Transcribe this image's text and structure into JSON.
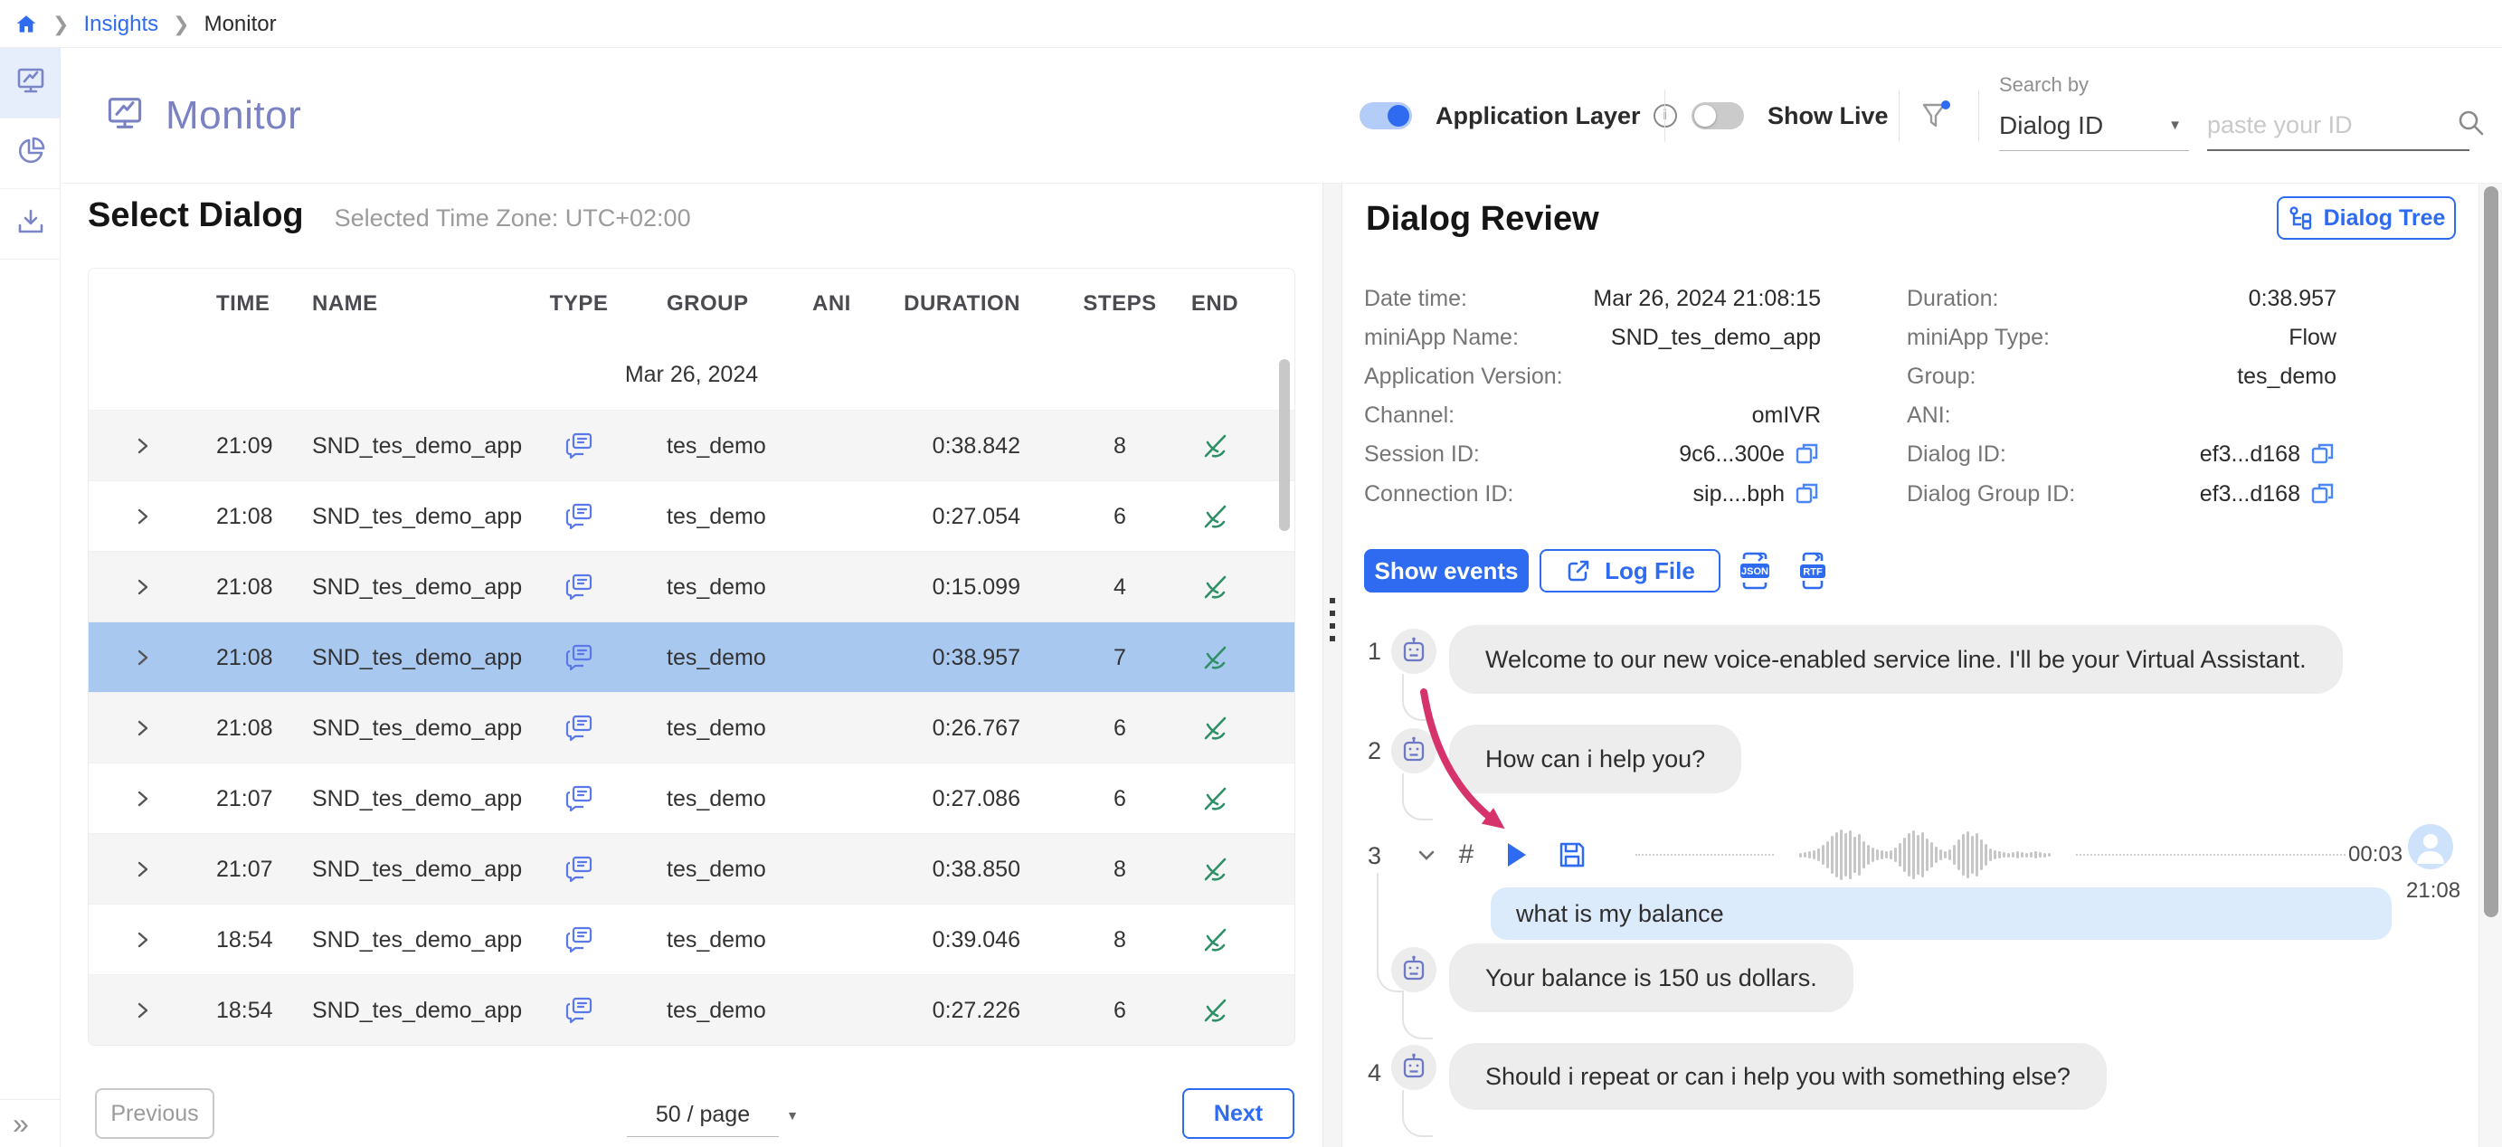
{
  "breadcrumb": {
    "insights": "Insights",
    "monitor": "Monitor"
  },
  "sidebar": {
    "collapse": "»"
  },
  "header": {
    "title": "Monitor",
    "app_layer_label": "Application Layer",
    "show_live_label": "Show Live",
    "search_by": "Search by",
    "search_type": "Dialog ID",
    "search_placeholder": "paste your ID"
  },
  "dialogs": {
    "heading": "Select Dialog",
    "timezone": "Selected Time Zone: UTC+02:00",
    "columns": {
      "time": "TIME",
      "name": "NAME",
      "type": "TYPE",
      "group": "GROUP",
      "ani": "ANI",
      "duration": "DURATION",
      "steps": "STEPS",
      "end": "END"
    },
    "date_group": "Mar 26, 2024",
    "rows": [
      {
        "time": "21:09",
        "name": "SND_tes_demo_app",
        "group": "tes_demo",
        "duration": "0:38.842",
        "steps": "8"
      },
      {
        "time": "21:08",
        "name": "SND_tes_demo_app",
        "group": "tes_demo",
        "duration": "0:27.054",
        "steps": "6"
      },
      {
        "time": "21:08",
        "name": "SND_tes_demo_app",
        "group": "tes_demo",
        "duration": "0:15.099",
        "steps": "4"
      },
      {
        "time": "21:08",
        "name": "SND_tes_demo_app",
        "group": "tes_demo",
        "duration": "0:38.957",
        "steps": "7"
      },
      {
        "time": "21:08",
        "name": "SND_tes_demo_app",
        "group": "tes_demo",
        "duration": "0:26.767",
        "steps": "6"
      },
      {
        "time": "21:07",
        "name": "SND_tes_demo_app",
        "group": "tes_demo",
        "duration": "0:27.086",
        "steps": "6"
      },
      {
        "time": "21:07",
        "name": "SND_tes_demo_app",
        "group": "tes_demo",
        "duration": "0:38.850",
        "steps": "8"
      },
      {
        "time": "18:54",
        "name": "SND_tes_demo_app",
        "group": "tes_demo",
        "duration": "0:39.046",
        "steps": "8"
      },
      {
        "time": "18:54",
        "name": "SND_tes_demo_app",
        "group": "tes_demo",
        "duration": "0:27.226",
        "steps": "6"
      }
    ],
    "pagination": {
      "previous": "Previous",
      "page_size": "50 / page",
      "next": "Next"
    }
  },
  "review": {
    "heading": "Dialog Review",
    "tree_button": "Dialog Tree",
    "fields_left": [
      {
        "label": "Date time:",
        "value": "Mar 26, 2024 21:08:15"
      },
      {
        "label": "miniApp Name:",
        "value": "SND_tes_demo_app"
      },
      {
        "label": "Application Version:",
        "value": ""
      },
      {
        "label": "Channel:",
        "value": "omIVR"
      },
      {
        "label": "Session ID:",
        "value": "9c6...300e"
      },
      {
        "label": "Connection ID:",
        "value": "sip....bph"
      }
    ],
    "fields_right": [
      {
        "label": "Duration:",
        "value": "0:38.957"
      },
      {
        "label": "miniApp Type:",
        "value": "Flow"
      },
      {
        "label": "Group:",
        "value": "tes_demo"
      },
      {
        "label": "ANI:",
        "value": ""
      },
      {
        "label": "Dialog ID:",
        "value": "ef3...d168"
      },
      {
        "label": "Dialog Group ID:",
        "value": "ef3...d168"
      }
    ],
    "show_events": "Show events",
    "log_file": "Log File",
    "export_json": "JSON",
    "export_rtf": "RTF",
    "steps": {
      "s1": {
        "num": "1",
        "text": "Welcome to our new voice-enabled service line. I'll be your Virtual Assistant."
      },
      "s2": {
        "num": "2",
        "text": "How can i help you?"
      },
      "s3": {
        "num": "3",
        "hash": "#",
        "duration": "00:03",
        "time": "21:08",
        "user_text": "what is my balance",
        "bot_text": "Your balance is 150 us dollars."
      },
      "s4": {
        "num": "4",
        "text": "Should i repeat or can i help you with something else?"
      }
    }
  },
  "colors": {
    "primary_blue": "#2e6bf0",
    "accent_purple": "#7b82c4",
    "selected_row": "#a9c8f0",
    "annotation_pink": "#d6336c",
    "end_call_green": "#2f8f66"
  }
}
